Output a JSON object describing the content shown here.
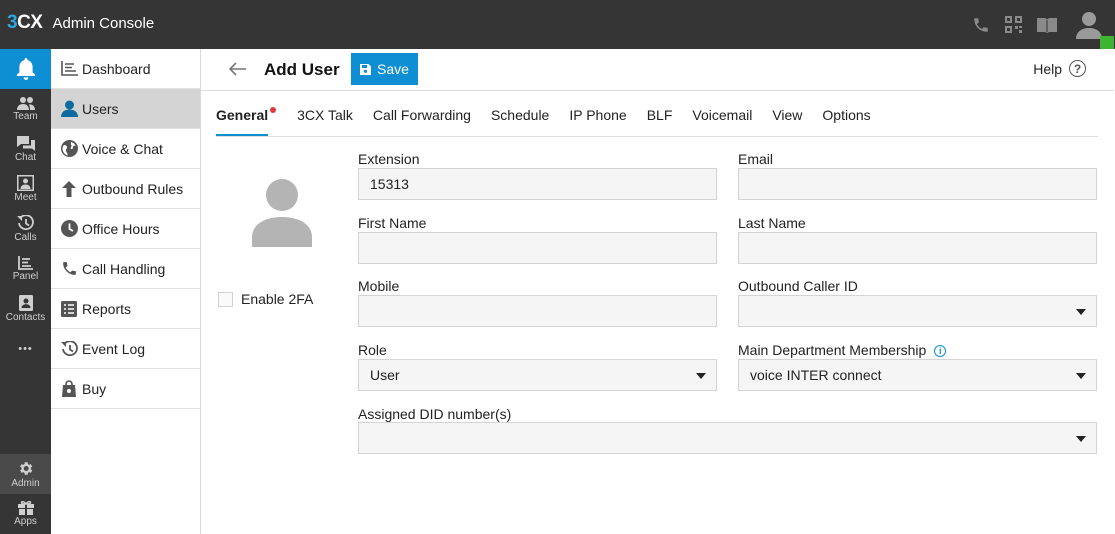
{
  "app": {
    "logo_prefix": "3",
    "logo_suffix": "CX",
    "title": "Admin Console"
  },
  "topbar": {
    "icons": [
      "phone-icon",
      "qr-code-icon",
      "book-icon",
      "user-avatar-icon"
    ],
    "status_color": "#3db532"
  },
  "rail": {
    "items": [
      {
        "label": "Team",
        "icon": "team-icon"
      },
      {
        "label": "Chat",
        "icon": "chat-icon"
      },
      {
        "label": "Meet",
        "icon": "meet-icon"
      },
      {
        "label": "Calls",
        "icon": "history-icon"
      },
      {
        "label": "Panel",
        "icon": "panel-icon"
      },
      {
        "label": "Contacts",
        "icon": "contacts-icon"
      },
      {
        "label": "Admin",
        "icon": "gear-icon"
      },
      {
        "label": "Apps",
        "icon": "apps-icon"
      }
    ],
    "more": "•••"
  },
  "nav": {
    "items": [
      {
        "label": "Dashboard",
        "icon": "dashboard-icon"
      },
      {
        "label": "Users",
        "icon": "user-icon",
        "active": true
      },
      {
        "label": "Voice & Chat",
        "icon": "globe-icon"
      },
      {
        "label": "Outbound Rules",
        "icon": "arrow-up-icon"
      },
      {
        "label": "Office Hours",
        "icon": "clock-icon"
      },
      {
        "label": "Call Handling",
        "icon": "phone-icon"
      },
      {
        "label": "Reports",
        "icon": "list-icon"
      },
      {
        "label": "Event Log",
        "icon": "history-icon"
      },
      {
        "label": "Buy",
        "icon": "shopping-bag-icon"
      }
    ]
  },
  "header": {
    "title": "Add User",
    "save_label": "Save",
    "help_label": "Help"
  },
  "tabs": [
    "General",
    "3CX Talk",
    "Call Forwarding",
    "Schedule",
    "IP Phone",
    "BLF",
    "Voicemail",
    "View",
    "Options"
  ],
  "form": {
    "enable_2fa_label": "Enable 2FA",
    "extension": {
      "label": "Extension",
      "value": "15313"
    },
    "email": {
      "label": "Email",
      "value": ""
    },
    "first_name": {
      "label": "First Name",
      "value": ""
    },
    "last_name": {
      "label": "Last Name",
      "value": ""
    },
    "mobile": {
      "label": "Mobile",
      "value": ""
    },
    "outbound_caller_id": {
      "label": "Outbound Caller ID",
      "value": ""
    },
    "role": {
      "label": "Role",
      "value": "User"
    },
    "main_department": {
      "label": "Main Department Membership",
      "value": "voice INTER connect"
    },
    "assigned_did": {
      "label": "Assigned DID number(s)",
      "value": ""
    }
  },
  "colors": {
    "accent": "#0e8fd3",
    "dark": "#353535",
    "required_dot": "#e23b3b"
  }
}
